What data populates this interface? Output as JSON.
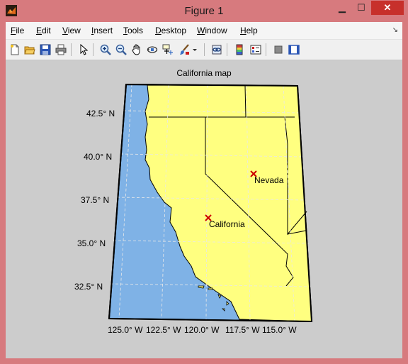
{
  "window": {
    "title": "Figure 1"
  },
  "menu": [
    "File",
    "Edit",
    "View",
    "Insert",
    "Tools",
    "Desktop",
    "Window",
    "Help"
  ],
  "menu_underline": [
    "F",
    "E",
    "V",
    "I",
    "T",
    "D",
    "W",
    "H"
  ],
  "toolbar": [
    "new-figure-icon",
    "open-file-icon",
    "save-icon",
    "print-icon",
    "pointer-icon",
    "zoom-in-icon",
    "zoom-out-icon",
    "pan-hand-icon",
    "rotate-3d-icon",
    "data-cursor-icon",
    "brush-icon",
    "brush-dropdown-icon",
    "link-plot-icon",
    "colorbar-icon",
    "legend-icon",
    "hide-plot-tools-icon",
    "show-plot-tools-icon"
  ],
  "axes": {
    "title": "California map",
    "lat_labels": [
      "42.5° N",
      "40.0° N",
      "37.5° N",
      "35.0° N",
      "32.5° N"
    ],
    "lon_labels": [
      "125.0° W",
      "122.5° W",
      "120.0° W",
      "117.5° W",
      "115.0° W"
    ]
  },
  "markers": [
    {
      "label": "California",
      "lat": 36.7,
      "lon": -119.4
    },
    {
      "label": "Nevada",
      "lat": 39.1,
      "lon": -116.8
    }
  ],
  "colors": {
    "land": "#ffff80",
    "ocean": "#7fb2e6",
    "marker": "#cc0000",
    "close": "#c7302b"
  }
}
